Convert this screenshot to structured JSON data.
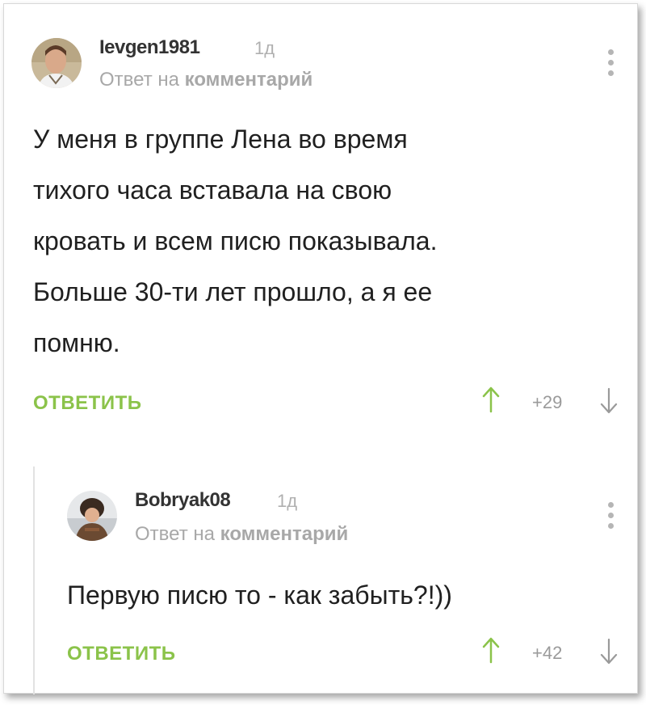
{
  "comments": [
    {
      "username": "Ievgen1981",
      "time": "1д",
      "reply_prefix": "Ответ на",
      "reply_target": "комментарий",
      "body_lines": [
        "У меня в группе Лена во время",
        "тихого часа вставала на свою",
        "кровать и всем писю показывала.",
        "Больше 30-ти лет прошло, а я ее",
        "помню."
      ],
      "reply_label": "ОТВЕТИТЬ",
      "rating": "+29"
    },
    {
      "username": "Bobryak08",
      "time": "1д",
      "reply_prefix": "Ответ на",
      "reply_target": "комментарий",
      "body_lines": [
        "Первую писю то - как забыть?!))"
      ],
      "reply_label": "ОТВЕТИТЬ",
      "rating": "+42"
    }
  ],
  "icons": {
    "upvote": "arrow-up-icon",
    "downvote": "arrow-down-icon",
    "menu": "kebab-menu-icon"
  },
  "colors": {
    "accent_green": "#8bc34a",
    "muted_text": "#a8a8a8",
    "body_text": "#202020"
  }
}
